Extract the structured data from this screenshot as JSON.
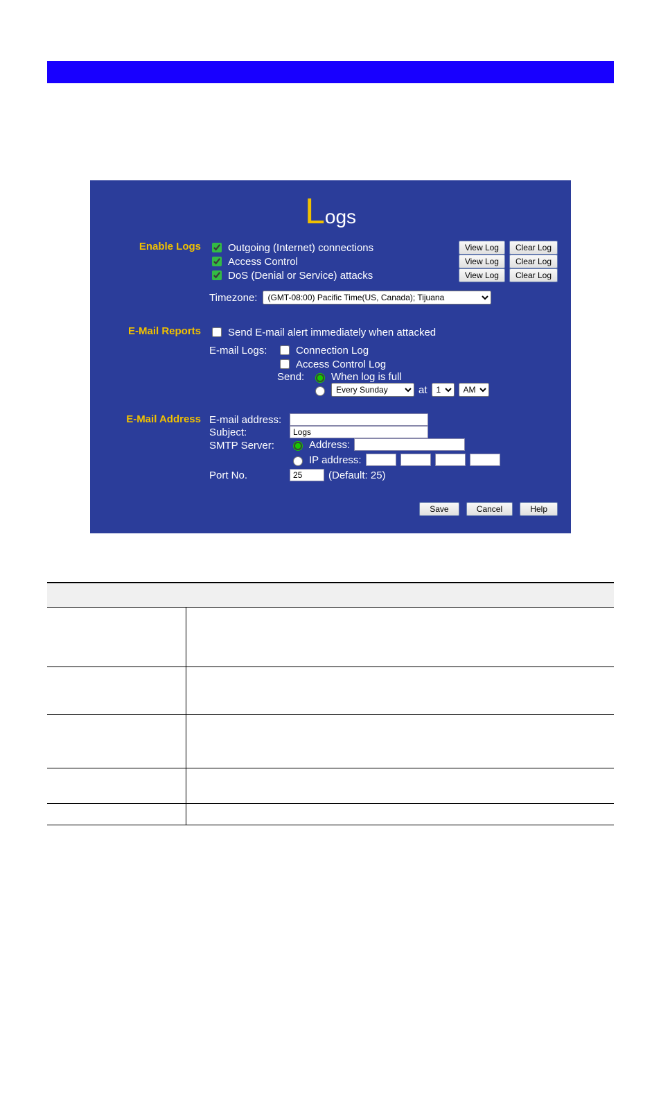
{
  "panel": {
    "title_big": "L",
    "title_rest": "ogs"
  },
  "enable_logs": {
    "heading": "Enable Logs",
    "items": [
      {
        "label": "Outgoing (Internet) connections",
        "view": "View Log",
        "clear": "Clear Log"
      },
      {
        "label": "Access Control",
        "view": "View Log",
        "clear": "Clear Log"
      },
      {
        "label": "DoS (Denial or Service) attacks",
        "view": "View Log",
        "clear": "Clear Log"
      }
    ],
    "timezone_label": "Timezone:",
    "timezone_value": "(GMT-08:00) Pacific Time(US, Canada); Tijuana"
  },
  "email_reports": {
    "heading": "E-Mail Reports",
    "alert_label": "Send E-mail alert immediately when attacked",
    "email_logs_label": "E-mail Logs:",
    "conn_log_label": "Connection Log",
    "access_log_label": "Access Control Log",
    "send_label": "Send:",
    "when_full_label": "When log is full",
    "sched_select_value": "Every Sunday",
    "at_label": "at",
    "hour_value": "1",
    "ampm_value": "AM"
  },
  "email_address": {
    "heading": "E-Mail Address",
    "email_label": "E-mail address:",
    "subject_label": "Subject:",
    "subject_value": "Logs",
    "smtp_label": "SMTP Server:",
    "addr_radio_label": "Address:",
    "ip_radio_label": "IP address:",
    "port_label": "Port No.",
    "port_value": "25",
    "port_default": "(Default: 25)"
  },
  "buttons": {
    "save": "Save",
    "cancel": "Cancel",
    "help": "Help"
  },
  "table_row_heights": [
    85,
    68,
    76,
    50,
    30
  ]
}
